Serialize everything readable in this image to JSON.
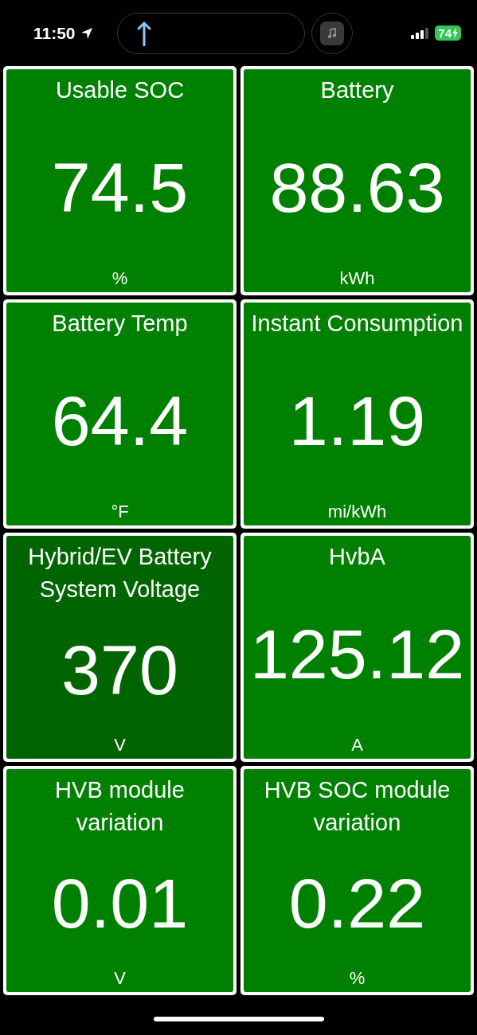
{
  "status_bar": {
    "time": "11:50",
    "battery": "74"
  },
  "tiles": [
    {
      "title": "Usable SOC",
      "value": "74.5",
      "unit": "%",
      "color": "#008000"
    },
    {
      "title": "Battery",
      "value": "88.63",
      "unit": "kWh",
      "color": "#008000"
    },
    {
      "title": "Battery Temp",
      "value": "64.4",
      "unit": "°F",
      "color": "#008000"
    },
    {
      "title": "Instant Consumption",
      "value": "1.19",
      "unit": "mi/kWh",
      "color": "#008000"
    },
    {
      "title": "Hybrid/EV Battery System Voltage",
      "value": "370",
      "unit": "V",
      "color": "#006400"
    },
    {
      "title": "HvbA",
      "value": "125.12",
      "unit": "A",
      "color": "#008000"
    },
    {
      "title": "HVB module variation",
      "value": "0.01",
      "unit": "V",
      "color": "#008000"
    },
    {
      "title": "HVB SOC module variation",
      "value": "0.22",
      "unit": "%",
      "color": "#008000"
    }
  ]
}
